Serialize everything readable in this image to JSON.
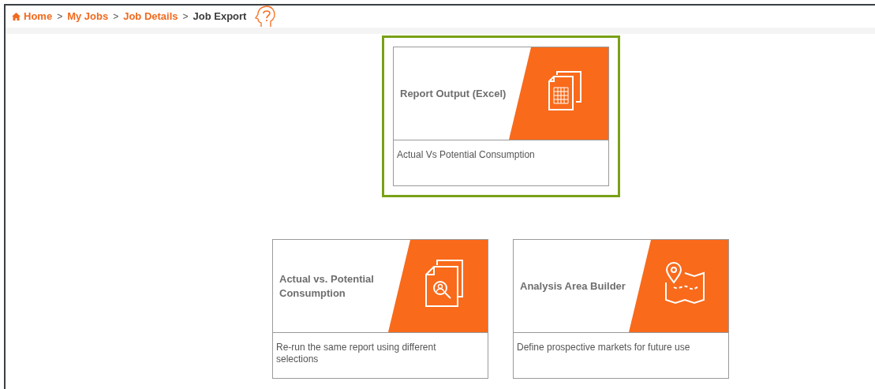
{
  "breadcrumb": [
    {
      "label": "Home",
      "kind": "home",
      "current": false
    },
    {
      "label": "My Jobs",
      "kind": "link",
      "current": false
    },
    {
      "label": "Job Details",
      "kind": "link",
      "current": false
    },
    {
      "label": "Job Export",
      "kind": "link",
      "current": true
    }
  ],
  "separator": ">",
  "cards": [
    {
      "title": "Report Output (Excel)",
      "description": "Actual Vs Potential Consumption",
      "kind": "spreadsheet",
      "selected": true
    },
    {
      "title": "Actual vs. Potential Consumption",
      "description": "Re-run the same report using different selections",
      "kind": "search-document",
      "selected": false
    },
    {
      "title": "Analysis Area Builder",
      "description": "Define prospective markets for future use",
      "kind": "map",
      "selected": false
    }
  ]
}
